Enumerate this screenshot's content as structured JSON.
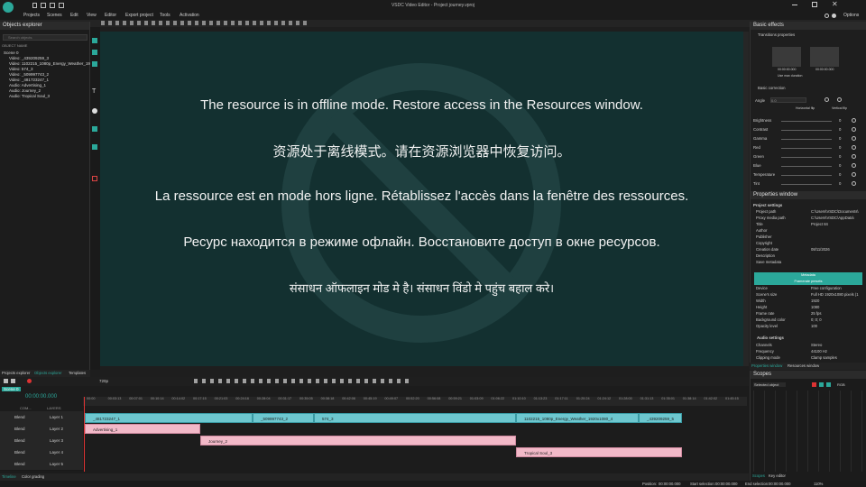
{
  "app": {
    "window_title": "VSDC Video Editor - Project journey.vproj",
    "options_label": "Options"
  },
  "menu": [
    "Projects",
    "Scenes",
    "Edit",
    "View",
    "Editor",
    "Export project",
    "Tools",
    "Activation"
  ],
  "objects_explorer": {
    "title": "Objects explorer",
    "search_placeholder": "Search objects",
    "column_header": "OBJECT NAME",
    "items": [
      "Scene 0",
      "Video: _439209259_3",
      "Video: 1102215_1080p_Energy_Weather_1920x1080",
      "Video: 574_3",
      "Video: _509997743_2",
      "Video: _481723247_1",
      "Audio: Advertising_1",
      "Audio: Journey_2",
      "Audio: Tropical Soul_3"
    ],
    "tabs": [
      "Projects explorer",
      "Objects explorer",
      "Templates"
    ]
  },
  "preview": {
    "messages": [
      "The resource is in offline mode. Restore access in the Resources window.",
      "资源处于离线模式。请在资源浏览器中恢复访问。",
      "La ressource est en mode hors ligne. Rétablissez l'accès dans la fenêtre des ressources.",
      "Ресурс находится в режиме офлайн. Восстановите доступ в окне ресурсов.",
      "संसाधन ऑफलाइन मोड मे है। संसाधन विंडो मे पहुंच बहाल करे।"
    ],
    "quality": "720p",
    "bg_color": "#133030"
  },
  "basic_effects": {
    "title": "Basic effects",
    "transitions_label": "Transitions properties",
    "time_left": "00:00:00.000",
    "time_right": "00:00:00.000",
    "use_max_duration": "Use max duration",
    "basic_correction": "Basic correction",
    "angle_label": "Angle",
    "angle_value": "0.0",
    "horizontal_flip": "Horizontal flip",
    "vertical_flip": "Vertical flip",
    "corrections": [
      {
        "label": "Brightness",
        "value": "0"
      },
      {
        "label": "Contrast",
        "value": "0"
      },
      {
        "label": "Gamma",
        "value": "0"
      },
      {
        "label": "Red",
        "value": "0"
      },
      {
        "label": "Green",
        "value": "0"
      },
      {
        "label": "Blue",
        "value": "0"
      },
      {
        "label": "Temperature",
        "value": "0"
      },
      {
        "label": "Tint",
        "value": "0"
      }
    ]
  },
  "properties": {
    "title": "Properties window",
    "section_project": "Project settings",
    "rows": [
      {
        "label": "Project path",
        "value": "C:\\Users\\VSDC\\Documents\\"
      },
      {
        "label": "Proxy media path",
        "value": "C:\\Users\\VSDC\\AppData\\"
      },
      {
        "label": "Title",
        "value": "Project 84"
      },
      {
        "label": "Author",
        "value": ""
      },
      {
        "label": "Publisher",
        "value": ""
      },
      {
        "label": "Copyright",
        "value": ""
      },
      {
        "label": "Creation date",
        "value": "08/11/2026"
      },
      {
        "label": "Description",
        "value": ""
      },
      {
        "label": "Save metadata",
        "value": ""
      }
    ],
    "btn_metadata": "Metadata",
    "btn_presets": "Framerate presets",
    "rows2": [
      {
        "label": "Device",
        "value": "Free configuration"
      },
      {
        "label": "Scene's size",
        "value": "Full HD 1920x1080 pixels (1"
      },
      {
        "label": "Width",
        "value": "1920"
      },
      {
        "label": "Height",
        "value": "1080"
      },
      {
        "label": "Frame rate",
        "value": "25 fps"
      },
      {
        "label": "Background color",
        "value": "0; 0; 0"
      },
      {
        "label": "Opacity level",
        "value": "100"
      }
    ],
    "section_audio": "Audio settings",
    "rows3": [
      {
        "label": "Channels",
        "value": "Stereo"
      },
      {
        "label": "Frequency",
        "value": "44100 Hz"
      },
      {
        "label": "Clipping mode",
        "value": "Clamp samples"
      }
    ],
    "tabs": [
      "Properties window",
      "Resources window"
    ]
  },
  "scopes": {
    "title": "Scopes",
    "selector": "Selected object",
    "mode": "RGB",
    "tabs": [
      "Scopes",
      "Key editor"
    ]
  },
  "timeline": {
    "scene_tab": "Scene 0",
    "timecode": "00:00:00.000",
    "header_com": "COM...",
    "header_layers": "LAYERS",
    "ruler": [
      "00:00",
      "00:03:13",
      "00:07:01",
      "00:10:14",
      "00:14:02",
      "00:17:15",
      "00:21:03",
      "00:24:16",
      "00:28:04",
      "00:31:17",
      "00:35:05",
      "00:38:18",
      "00:42:06",
      "00:45:19",
      "00:49:07",
      "00:52:20",
      "00:56:08",
      "00:59:21",
      "01:03:09",
      "01:06:22",
      "01:10:10",
      "01:13:23",
      "01:17:11",
      "01:20:24",
      "01:24:12",
      "01:28:00",
      "01:31:13",
      "01:35:01",
      "01:38:14",
      "01:42:02",
      "01:45:15"
    ],
    "layers": [
      {
        "blend": "Blend",
        "name": "Layer 1"
      },
      {
        "blend": "Blend",
        "name": "Layer 2"
      },
      {
        "blend": "Blend",
        "name": "Layer 3"
      },
      {
        "blend": "Blend",
        "name": "Layer 4"
      },
      {
        "blend": "Blend",
        "name": "Layer 5"
      }
    ],
    "video_clips": [
      "_481723247_1",
      "_509997743_2",
      "574_3",
      "1102215_1080p_Energy_Weather_1920x1080_4",
      "_439209259_5"
    ],
    "audio_clips": [
      "Advertising_1",
      "Journey_2",
      "Tropical Soul_3"
    ],
    "bottom_tabs": [
      "Timeline",
      "Color grading"
    ]
  },
  "status": {
    "position_label": "Position:",
    "position_value": "00:00:00.000",
    "start_label": "Start selection:",
    "start_value": "00:00:00.000",
    "end_label": "End selection:",
    "end_value": "00:00:00.000",
    "zoom": "110%"
  },
  "colors": {
    "accent": "#2ba89a",
    "video_clip": "#6dc7cf",
    "audio_clip": "#f2b9c8"
  }
}
